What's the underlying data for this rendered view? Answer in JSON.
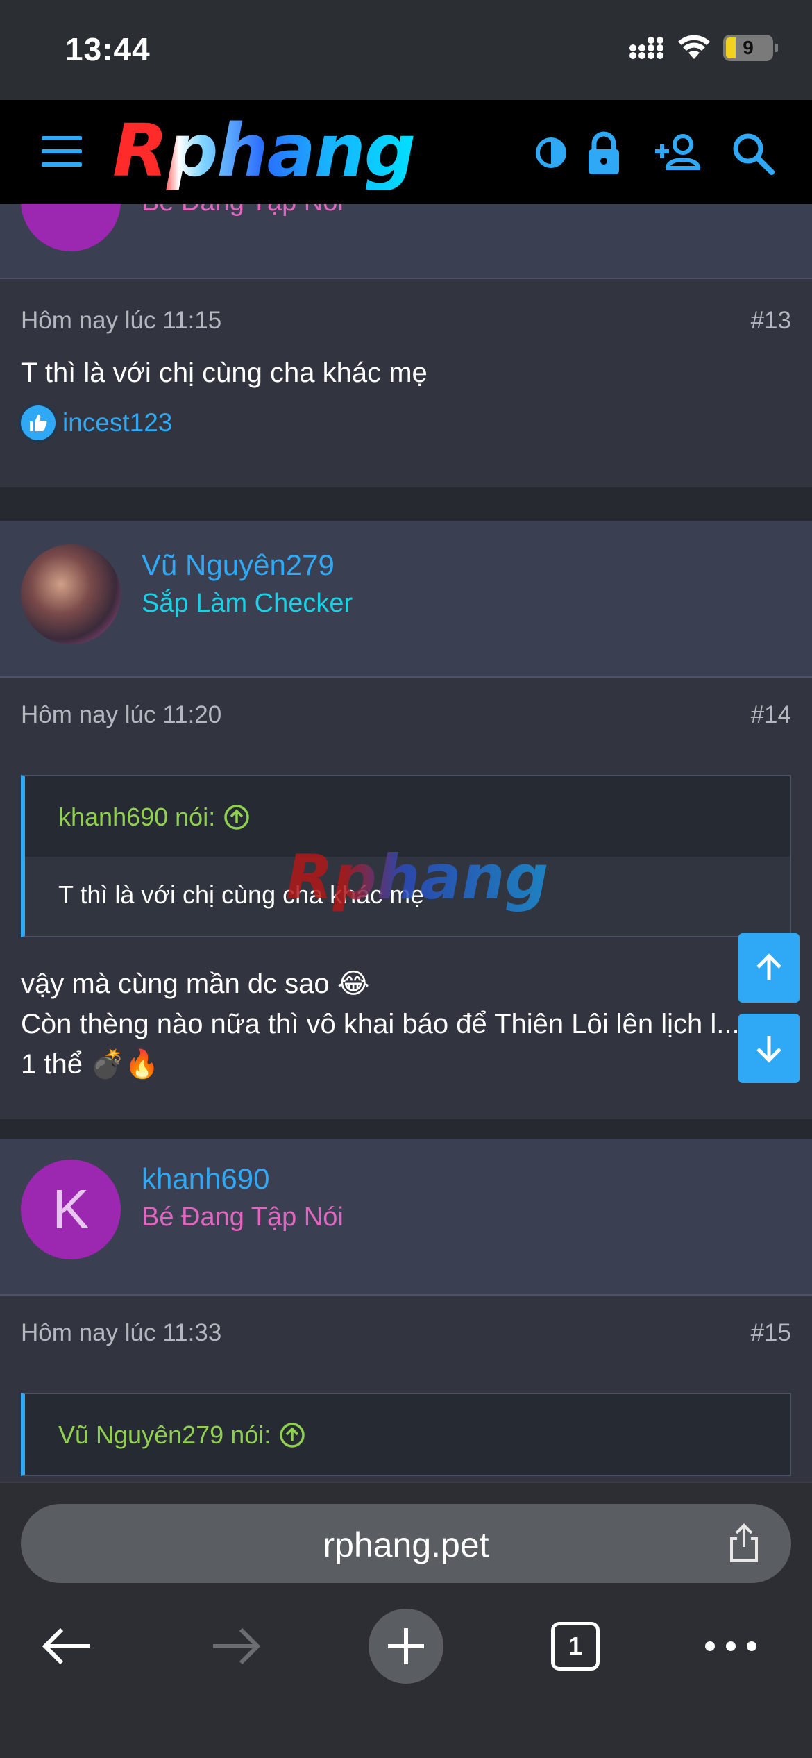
{
  "status": {
    "time": "13:44",
    "battery": "9"
  },
  "header": {
    "logo_text": "Rphang"
  },
  "posts": {
    "top_partial": {
      "user_title": "Bé Đang Tập Nói"
    },
    "p13": {
      "date": "Hôm nay lúc 11:15",
      "number": "#13",
      "message": "T thì là với chị cùng cha khác mẹ",
      "reaction_user": "incest123"
    },
    "p14": {
      "username": "Vũ Nguyên279",
      "user_title": "Sắp Làm Checker",
      "date": "Hôm nay lúc 11:20",
      "number": "#14",
      "quote_author": "khanh690 nói:",
      "quote_text": "T thì là với chị cùng cha khác mẹ",
      "message_line1": "vậy mà cùng mần dc sao 😂",
      "message_line2": "Còn thèng nào nữa thì vô khai báo để Thiên Lôi lên lịch l...",
      "message_line3": "1 thể 💣🔥"
    },
    "p15": {
      "avatar_letter": "K",
      "username": "khanh690",
      "user_title": "Bé Đang Tập Nói",
      "date": "Hôm nay lúc 11:33",
      "number": "#15",
      "quote_author": "Vũ Nguyên279 nói:"
    }
  },
  "watermark": "Rphang",
  "browser": {
    "url": "rphang.pet",
    "tab_count": "1"
  },
  "colors": {
    "accent": "#2fa9f5",
    "pink_title": "#e066c0",
    "cyan_title": "#19d1e6",
    "quote_author": "#8fd14f"
  }
}
